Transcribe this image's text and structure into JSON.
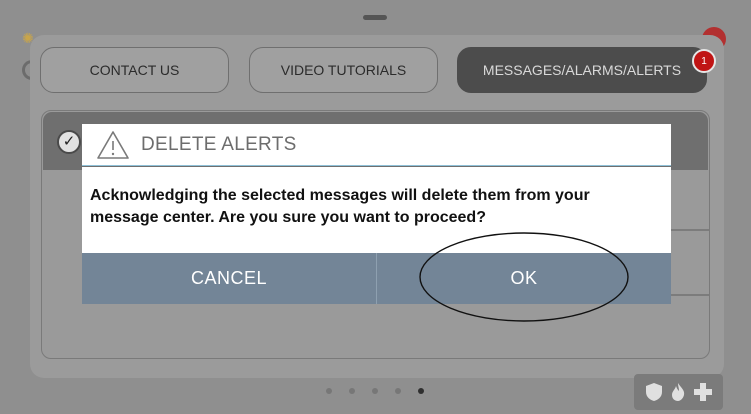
{
  "tabs": [
    {
      "label": "CONTACT US"
    },
    {
      "label": "VIDEO TUTORIALS"
    },
    {
      "label": "MESSAGES/ALARMS/ALERTS",
      "badge": "1",
      "active": true
    }
  ],
  "list": {
    "select_all_icon": "checkmark-icon"
  },
  "pagination": {
    "count": 5,
    "active_index": 4
  },
  "mode_icons": [
    "shield-icon",
    "flame-icon",
    "medical-cross-icon"
  ],
  "dialog": {
    "icon": "warning-triangle-icon",
    "title": "DELETE ALERTS",
    "message": "Acknowledging the selected messages will delete them from your message center. Are you sure you want to proceed?",
    "cancel_label": "CANCEL",
    "ok_label": "OK"
  },
  "colors": {
    "dialog_button_bar": "#738597",
    "badge": "#c01414",
    "active_tab": "#4c4c4c"
  }
}
